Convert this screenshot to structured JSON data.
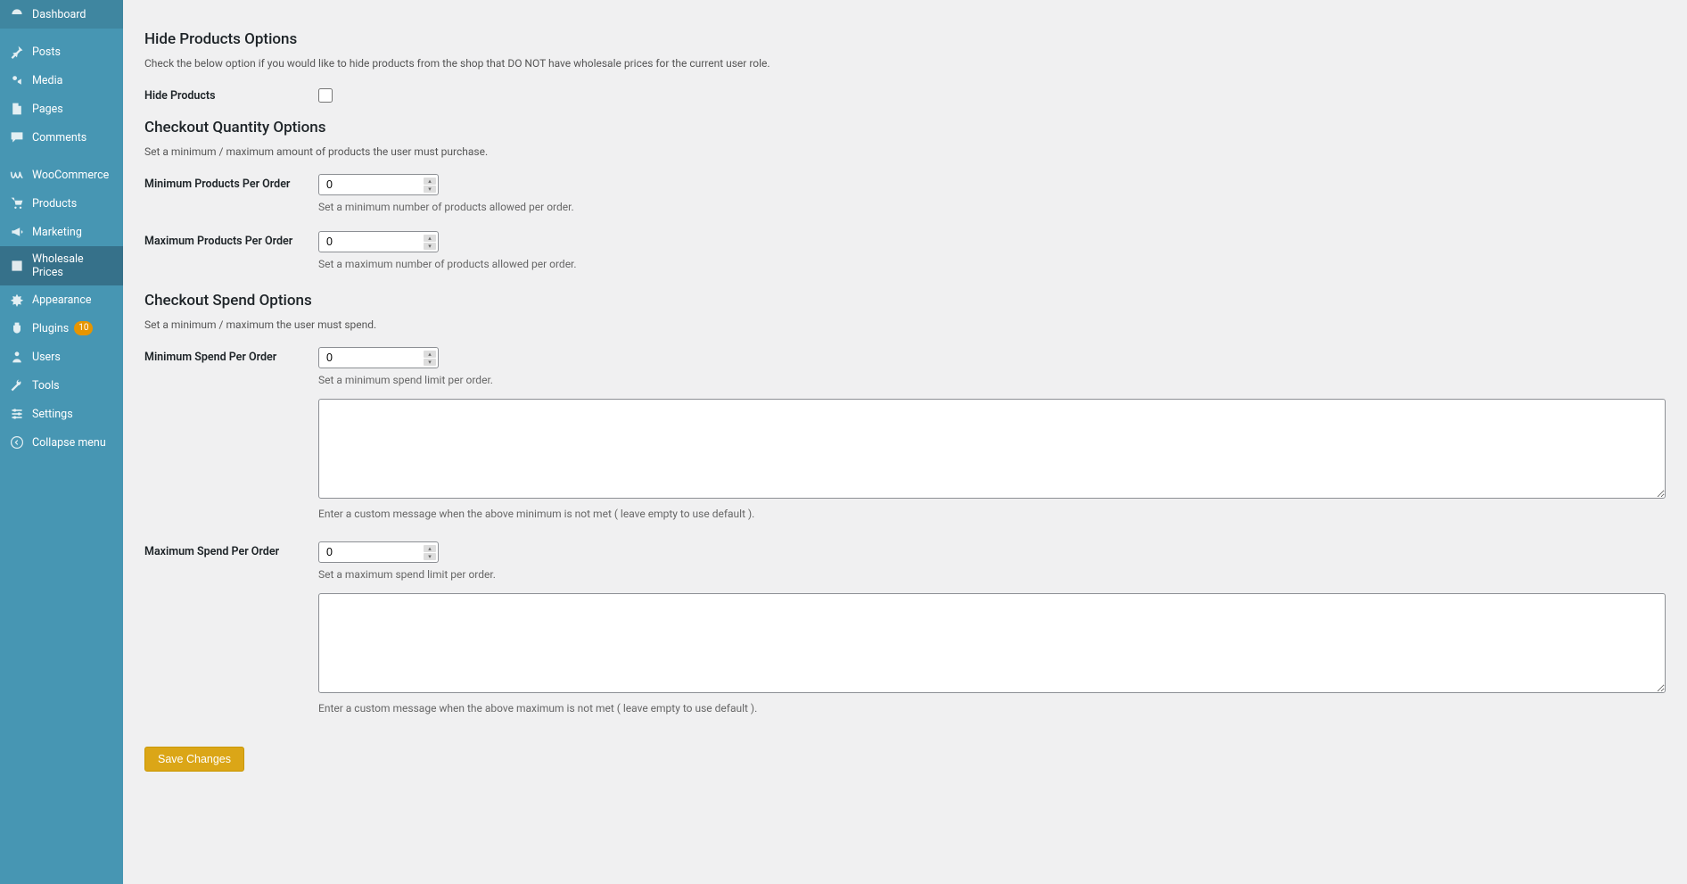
{
  "sidebar": {
    "items": [
      {
        "label": "Dashboard",
        "icon": "dashboard"
      },
      {
        "label": "Posts",
        "icon": "pin"
      },
      {
        "label": "Media",
        "icon": "media"
      },
      {
        "label": "Pages",
        "icon": "page"
      },
      {
        "label": "Comments",
        "icon": "comment"
      },
      {
        "label": "WooCommerce",
        "icon": "woo"
      },
      {
        "label": "Products",
        "icon": "products"
      },
      {
        "label": "Marketing",
        "icon": "megaphone"
      },
      {
        "label": "Wholesale Prices",
        "icon": "wholesale",
        "active": true
      },
      {
        "label": "Appearance",
        "icon": "appearance"
      },
      {
        "label": "Plugins",
        "icon": "plugins",
        "badge": "10"
      },
      {
        "label": "Users",
        "icon": "users"
      },
      {
        "label": "Tools",
        "icon": "tools"
      },
      {
        "label": "Settings",
        "icon": "settings"
      },
      {
        "label": "Collapse menu",
        "icon": "collapse"
      }
    ]
  },
  "sections": {
    "hide_products": {
      "title": "Hide Products Options",
      "desc": "Check the below option if you would like to hide products from the shop that DO NOT have wholesale prices for the current user role.",
      "checkbox_label": "Hide Products",
      "checkbox_value": false
    },
    "checkout_qty": {
      "title": "Checkout Quantity Options",
      "desc": "Set a minimum / maximum amount of products the user must purchase.",
      "min_label": "Minimum Products Per Order",
      "min_value": "0",
      "min_help": "Set a minimum number of products allowed per order.",
      "max_label": "Maximum Products Per Order",
      "max_value": "0",
      "max_help": "Set a maximum number of products allowed per order."
    },
    "checkout_spend": {
      "title": "Checkout Spend Options",
      "desc": "Set a minimum / maximum the user must spend.",
      "min_label": "Minimum Spend Per Order",
      "min_value": "0",
      "min_help": "Set a minimum spend limit per order.",
      "min_msg_value": "",
      "min_msg_help": "Enter a custom message when the above minimum is not met ( leave empty to use default ).",
      "max_label": "Maximum Spend Per Order",
      "max_value": "0",
      "max_help": "Set a maximum spend limit per order.",
      "max_msg_value": "",
      "max_msg_help": "Enter a custom message when the above maximum is not met ( leave empty to use default )."
    }
  },
  "save_button": "Save Changes"
}
